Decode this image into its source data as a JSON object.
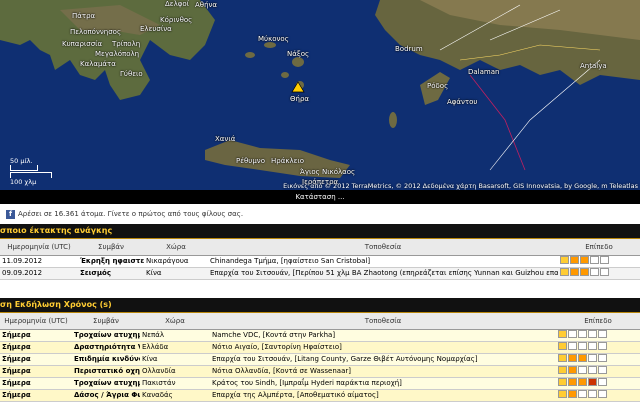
{
  "map": {
    "labels": [
      {
        "text": "Δελφοί"
      },
      {
        "text": "Αθήνα"
      },
      {
        "text": "Πάτρα"
      },
      {
        "text": "Κόρινθος"
      },
      {
        "text": "Πελοπόννησος"
      },
      {
        "text": "Κυπαρισσία"
      },
      {
        "text": "Τρίπολη"
      },
      {
        "text": "Μεγαλόπολη"
      },
      {
        "text": "Καλαμάτα"
      },
      {
        "text": "Μύκονος"
      },
      {
        "text": "Νάξος"
      },
      {
        "text": "Θήρα"
      },
      {
        "text": "Χανιά"
      },
      {
        "text": "Ρέθυμνο"
      },
      {
        "text": "Ηράκλειο"
      },
      {
        "text": "Άγιος Νικόλαος"
      },
      {
        "text": "Ιεράπετρα"
      },
      {
        "text": "Bodrum"
      },
      {
        "text": "Dalaman"
      },
      {
        "text": "Antalya"
      },
      {
        "text": "Ρόδος"
      },
      {
        "text": "Αφάντου"
      },
      {
        "text": "Ελευσίνα"
      },
      {
        "text": "Γύθειο"
      }
    ],
    "scale_mi": "50 μίλ.",
    "scale_km": "100 χλμ",
    "attribution": "Εικόνες από © 2012 TerraMetrics, © 2012 Δεδομένα χάρτη Basarsoft, GIS Innovatsia, by Google, m Teleatlas",
    "status": "Κατάσταση ..."
  },
  "fb": {
    "icon": "facebook-icon",
    "text": "Αρέσει σε 16.361 άτομα. Γίνετε ο πρώτος από τους φίλους σας."
  },
  "emergency": {
    "title": "σποιο έκτακτης ανάγκης",
    "headers": {
      "date": "Ημερομηνία (UTC)",
      "event": "Συμβάν",
      "country": "Χώρα",
      "location": "Τοποθεσία",
      "level": "Επίπεδο"
    },
    "rows": [
      {
        "date": "11.09.2012",
        "event": "Έκρηξη ηφαιστείου",
        "country": "Νικαράγουα",
        "location": "Chinandega Τμήμα, [ηφαίστειο San Cristobal]"
      },
      {
        "date": "09.09.2012",
        "event": "Σεισμός",
        "country": "Κίνα",
        "location": "Επαρχία του Σιτσουάν, [Περίπου 51 χλμ ΒΑ Zhaotong (επηρεάζεται επίσης Yunnan και Guizhou επαρχία)]"
      }
    ]
  },
  "live": {
    "title": "ση Εκδήλωση Χρόνος (s)",
    "headers": {
      "date": "Ημερομηνία (UTC)",
      "event": "Συμβάν",
      "country": "Χώρα",
      "location": "Τοποθεσία",
      "level": "Επίπεδο"
    },
    "rows": [
      {
        "date": "Σήμερα",
        "event": "Τροχαίων ατυχημάτων",
        "country": "Νεπάλ",
        "location": "Namche VDC, [Κοντά στην Parkha]"
      },
      {
        "date": "Σήμερα",
        "event": "Δραστηριότητα Volcano",
        "country": "Ελλάδα",
        "location": "Νότιο Αιγαίο, [Σαντορίνη Ηφαίστειο]"
      },
      {
        "date": "Σήμερα",
        "event": "Επιδημία κινδύνου",
        "country": "Κίνα",
        "location": "Επαρχία του Σιτσουάν, [Litang County, Garze Θιβέτ Αυτόνομης Νομαρχίας]"
      },
      {
        "date": "Σήμερα",
        "event": "Περιστατικό οχημάτων",
        "country": "Ολλανδία",
        "location": "Νότια Ολλανδία, [Κοντά σε Wassenaar]"
      },
      {
        "date": "Σήμερα",
        "event": "Τροχαίων ατυχημάτων",
        "country": "Πακιστάν",
        "location": "Κράτος του Sindh, [Ιμπραΐμ Hyderi παράκτια περιοχή]"
      },
      {
        "date": "Σήμερα",
        "event": "Δάσος / Άγρια Φωτιά",
        "country": "Καναδάς",
        "location": "Επαρχία της Αλμπέρτα, [Αποθεματικό αίματος]"
      }
    ]
  },
  "colors": {
    "level_high": "#cc3300",
    "level_mid": "#ff9900",
    "level_low": "#ffcc33",
    "empty": "#ffffff"
  },
  "levels": {
    "emergency": [
      3,
      3
    ],
    "live": [
      1,
      1,
      3,
      2,
      4,
      2
    ]
  }
}
